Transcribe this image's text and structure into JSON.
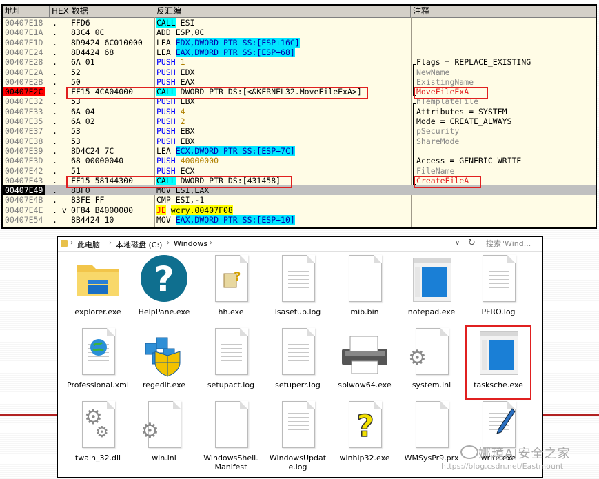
{
  "debugger": {
    "headers": {
      "addr": "地址",
      "hex": "HEX 数据",
      "disasm": "反汇编",
      "comment": "注释"
    },
    "rows": [
      {
        "addr": "00407E18",
        "mark": ".",
        "hex": "FFD6",
        "mn": "CALL",
        "ops": "ESI",
        "comment": ""
      },
      {
        "addr": "00407E1A",
        "mark": ".",
        "hex": "83C4 0C",
        "mn": "ADD",
        "ops": "ESP,0C",
        "comment": ""
      },
      {
        "addr": "00407E1D",
        "mark": ".",
        "hex": "8D9424 6C010000",
        "mn": "LEA",
        "ops": "EDX,DWORD PTR SS:[ESP+16C]",
        "comment": ""
      },
      {
        "addr": "00407E24",
        "mark": ".",
        "hex": "8D4424 68",
        "mn": "LEA",
        "ops": "EAX,DWORD PTR SS:[ESP+68]",
        "comment": ""
      },
      {
        "addr": "00407E28",
        "mark": ".",
        "hex": "6A 01",
        "mn": "PUSH",
        "ops": "1",
        "comment": "Flags = REPLACE_EXISTING"
      },
      {
        "addr": "00407E2A",
        "mark": ".",
        "hex": "52",
        "mn": "PUSH",
        "ops": "EDX",
        "comment": "NewName"
      },
      {
        "addr": "00407E2B",
        "mark": ".",
        "hex": "50",
        "mn": "PUSH",
        "ops": "EAX",
        "comment": "ExistingName"
      },
      {
        "addr": "00407E2C",
        "mark": ".",
        "hex": "FF15 4CA04000",
        "mn": "CALL",
        "ops": "DWORD PTR DS:[<&KERNEL32.MoveFileExA>]",
        "comment": "MoveFileExA"
      },
      {
        "addr": "00407E32",
        "mark": ".",
        "hex": "53",
        "mn": "PUSH",
        "ops": "EBX",
        "comment": "hTemplateFile"
      },
      {
        "addr": "00407E33",
        "mark": ".",
        "hex": "6A 04",
        "mn": "PUSH",
        "ops": "4",
        "comment": "Attributes = SYSTEM"
      },
      {
        "addr": "00407E35",
        "mark": ".",
        "hex": "6A 02",
        "mn": "PUSH",
        "ops": "2",
        "comment": "Mode = CREATE_ALWAYS"
      },
      {
        "addr": "00407E37",
        "mark": ".",
        "hex": "53",
        "mn": "PUSH",
        "ops": "EBX",
        "comment": "pSecurity"
      },
      {
        "addr": "00407E38",
        "mark": ".",
        "hex": "53",
        "mn": "PUSH",
        "ops": "EBX",
        "comment": "ShareMode"
      },
      {
        "addr": "00407E39",
        "mark": ".",
        "hex": "8D4C24 7C",
        "mn": "LEA",
        "ops": "ECX,DWORD PTR SS:[ESP+7C]",
        "comment": ""
      },
      {
        "addr": "00407E3D",
        "mark": ".",
        "hex": "68 00000040",
        "mn": "PUSH",
        "ops": "40000000",
        "comment": "Access = GENERIC_WRITE"
      },
      {
        "addr": "00407E42",
        "mark": ".",
        "hex": "51",
        "mn": "PUSH",
        "ops": "ECX",
        "comment": "FileName"
      },
      {
        "addr": "00407E43",
        "mark": ".",
        "hex": "FF15 58144300",
        "mn": "CALL",
        "ops": "DWORD PTR DS:[431458]",
        "comment": "CreateFileA"
      },
      {
        "addr": "00407E49",
        "mark": ".",
        "hex": "8BF0",
        "mn": "MOV",
        "ops": "ESI,EAX",
        "comment": ""
      },
      {
        "addr": "00407E4B",
        "mark": ".",
        "hex": "83FE FF",
        "mn": "CMP",
        "ops": "ESI,-1",
        "comment": ""
      },
      {
        "addr": "00407E4E",
        "mark": ". v",
        "hex": "0F84 B4000000",
        "mn": "JE",
        "ops": "wcry.00407F08",
        "comment": ""
      },
      {
        "addr": "00407E54",
        "mark": ".",
        "hex": "8B4424 10",
        "mn": "MOV",
        "ops": "EAX,DWORD PTR SS:[ESP+10]",
        "comment": ""
      }
    ]
  },
  "explorer": {
    "breadcrumb": [
      "此电脑",
      "本地磁盘 (C:)",
      "Windows"
    ],
    "search_placeholder": "搜索\"Wind...",
    "files": [
      {
        "name": "explorer.exe",
        "icon": "folder-icon"
      },
      {
        "name": "HelpPane.exe",
        "icon": "help-icon"
      },
      {
        "name": "hh.exe",
        "icon": "help-doc-icon"
      },
      {
        "name": "lsasetup.log",
        "icon": "text-file-icon"
      },
      {
        "name": "mib.bin",
        "icon": "blank-file-icon"
      },
      {
        "name": "notepad.exe",
        "icon": "window-icon"
      },
      {
        "name": "PFRO.log",
        "icon": "text-file-icon"
      },
      {
        "name": "Professional.xml",
        "icon": "xml-globe-icon"
      },
      {
        "name": "regedit.exe",
        "icon": "registry-icon"
      },
      {
        "name": "setupact.log",
        "icon": "text-file-icon"
      },
      {
        "name": "setuperr.log",
        "icon": "text-file-icon"
      },
      {
        "name": "splwow64.exe",
        "icon": "printer-icon"
      },
      {
        "name": "system.ini",
        "icon": "config-file-icon"
      },
      {
        "name": "tasksche.exe",
        "icon": "window-icon"
      },
      {
        "name": "twain_32.dll",
        "icon": "gear-file-icon"
      },
      {
        "name": "win.ini",
        "icon": "config-file-icon"
      },
      {
        "name": "WindowsShell.\nManifest",
        "icon": "blank-file-icon"
      },
      {
        "name": "WindowsUpdat\ne.log",
        "icon": "text-file-icon"
      },
      {
        "name": "winhlp32.exe",
        "icon": "help-question-icon"
      },
      {
        "name": "WMSysPr9.prx",
        "icon": "blank-file-icon"
      },
      {
        "name": "write.exe",
        "icon": "write-icon"
      }
    ]
  },
  "watermark": {
    "text": "娜璋AI安全之家",
    "url": "https://blog.csdn.net/Eastmount"
  }
}
